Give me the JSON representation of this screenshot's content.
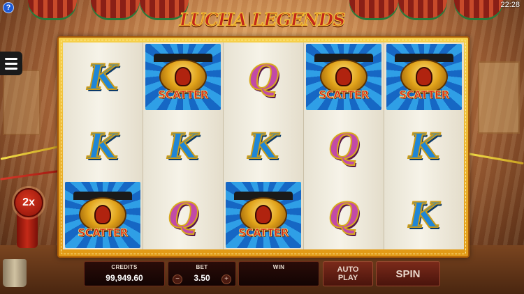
{
  "header": {
    "logo_left": "LUCHA",
    "logo_right": "LEGENDS",
    "clock": "22:28",
    "help_icon": "question-icon"
  },
  "multiplier": "2x",
  "symbols": {
    "k": "K",
    "q": "Q",
    "scatter": "SCATTER"
  },
  "reels": [
    [
      "K",
      "K",
      "SCATTER"
    ],
    [
      "SCATTER",
      "K",
      "Q"
    ],
    [
      "Q",
      "K",
      "SCATTER"
    ],
    [
      "SCATTER",
      "Q",
      "Q"
    ],
    [
      "SCATTER",
      "K",
      "K"
    ]
  ],
  "controls": {
    "credits_label": "CREDITS",
    "credits_value": "99,949.60",
    "bet_label": "BET",
    "bet_value": "3.50",
    "bet_minus": "−",
    "bet_plus": "+",
    "win_label": "WIN",
    "win_value": "",
    "autoplay_label_line1": "AUTO",
    "autoplay_label_line2": "PLAY",
    "spin_label": "SPIN"
  },
  "colors": {
    "frame_gold": "#f6d04a",
    "k_blue": "#1f86d6",
    "q_magenta": "#c24aa6",
    "scatter_red": "#d62412",
    "panel_dark": "#1a0604"
  }
}
